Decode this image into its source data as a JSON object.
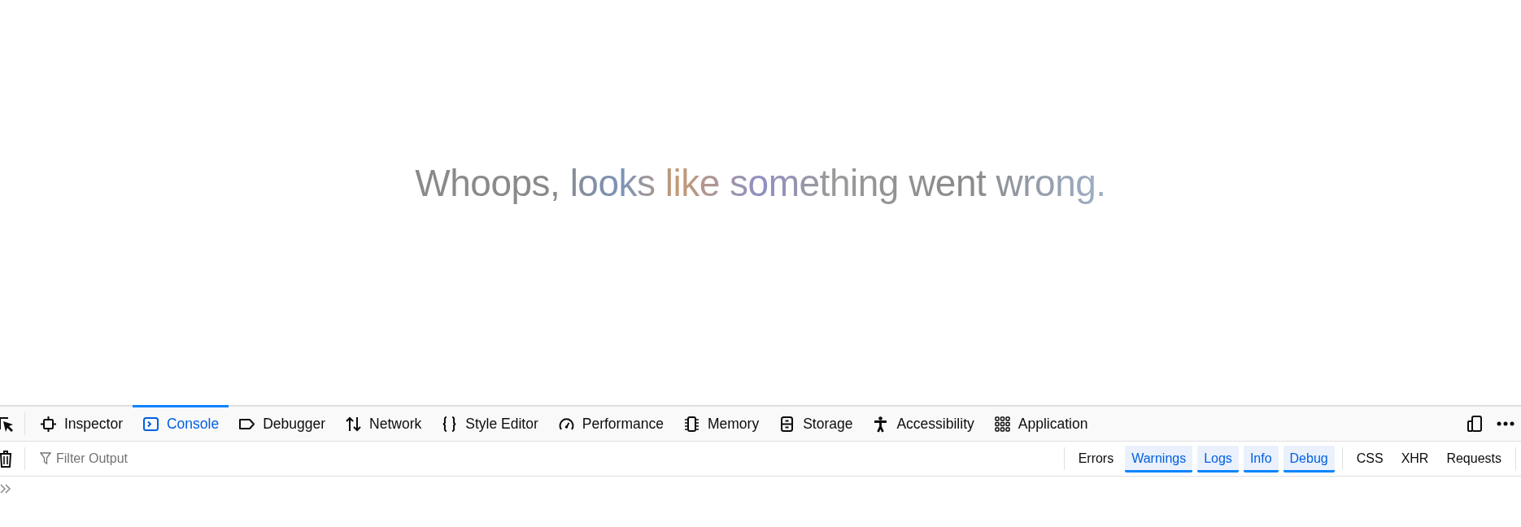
{
  "page": {
    "message": "Whoops, looks like something went wrong."
  },
  "devtools": {
    "tabs": [
      {
        "label": "Inspector",
        "selected": false
      },
      {
        "label": "Console",
        "selected": true
      },
      {
        "label": "Debugger",
        "selected": false
      },
      {
        "label": "Network",
        "selected": false
      },
      {
        "label": "Style Editor",
        "selected": false
      },
      {
        "label": "Performance",
        "selected": false
      },
      {
        "label": "Memory",
        "selected": false
      },
      {
        "label": "Storage",
        "selected": false
      },
      {
        "label": "Accessibility",
        "selected": false
      },
      {
        "label": "Application",
        "selected": false
      }
    ],
    "filter": {
      "placeholder": "Filter Output"
    },
    "levels": [
      {
        "label": "Errors",
        "selected": false
      },
      {
        "label": "Warnings",
        "selected": true
      },
      {
        "label": "Logs",
        "selected": true
      },
      {
        "label": "Info",
        "selected": true
      },
      {
        "label": "Debug",
        "selected": true
      }
    ],
    "categories": [
      {
        "label": "CSS",
        "selected": false
      },
      {
        "label": "XHR",
        "selected": false
      },
      {
        "label": "Requests",
        "selected": false
      }
    ]
  }
}
